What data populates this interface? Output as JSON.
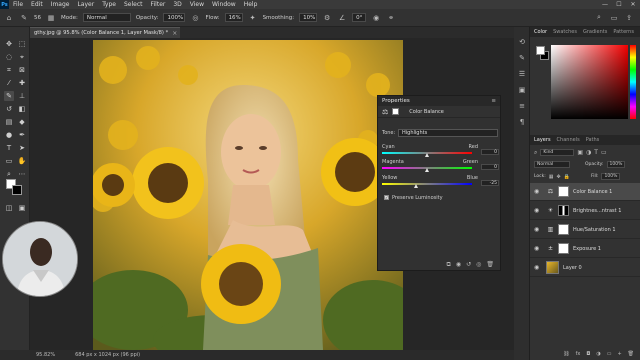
{
  "menubar": {
    "logo": "Ps",
    "items": [
      "File",
      "Edit",
      "Image",
      "Layer",
      "Type",
      "Select",
      "Filter",
      "3D",
      "View",
      "Window",
      "Help"
    ],
    "window_controls": [
      "—",
      "☐",
      "✕"
    ]
  },
  "options": {
    "brush_size": "56",
    "mode_label": "Mode:",
    "mode_value": "Normal",
    "opacity_label": "Opacity:",
    "opacity_value": "100%",
    "flow_label": "Flow:",
    "flow_value": "16%",
    "smoothing_label": "Smoothing:",
    "smoothing_value": "10%",
    "angle_value": "0°"
  },
  "document": {
    "tab_title": "gthy.jpg @ 95.8% (Color Balance 1, Layer Mask/8) *",
    "close_icon": "×"
  },
  "status": {
    "zoom": "95.82%",
    "size": "684 px x 1024 px (96 ppi)"
  },
  "properties": {
    "title": "Properties",
    "sub_title": "Color Balance",
    "tone_label": "Tone:",
    "tone_value": "Highlights",
    "sliders": [
      {
        "left": "Cyan",
        "right": "Red",
        "value": "0"
      },
      {
        "left": "Magenta",
        "right": "Green",
        "value": "0"
      },
      {
        "left": "Yellow",
        "right": "Blue",
        "value": "-25"
      }
    ],
    "preserve_label": "Preserve Luminosity"
  },
  "color_panel": {
    "tabs": [
      "Color",
      "Swatches",
      "Gradients",
      "Patterns"
    ]
  },
  "layers_panel": {
    "tabs": [
      "Layers",
      "Channels",
      "Paths"
    ],
    "kind_label": "Kind",
    "blend_mode": "Normal",
    "opacity_label": "Opacity:",
    "opacity_value": "100%",
    "lock_label": "Lock:",
    "fill_label": "Fill:",
    "fill_value": "100%",
    "layers": [
      {
        "name": "Color Balance 1",
        "icon": "color-balance-icon",
        "selected": true
      },
      {
        "name": "Brightnes...ntrast 1",
        "icon": "brightness-contrast-icon",
        "selected": false
      },
      {
        "name": "Hue/Saturation 1",
        "icon": "hue-saturation-icon",
        "selected": false
      },
      {
        "name": "Exposure 1",
        "icon": "exposure-icon",
        "selected": false
      },
      {
        "name": "Layer 0",
        "icon": "image-thumbnail",
        "selected": false
      }
    ]
  }
}
